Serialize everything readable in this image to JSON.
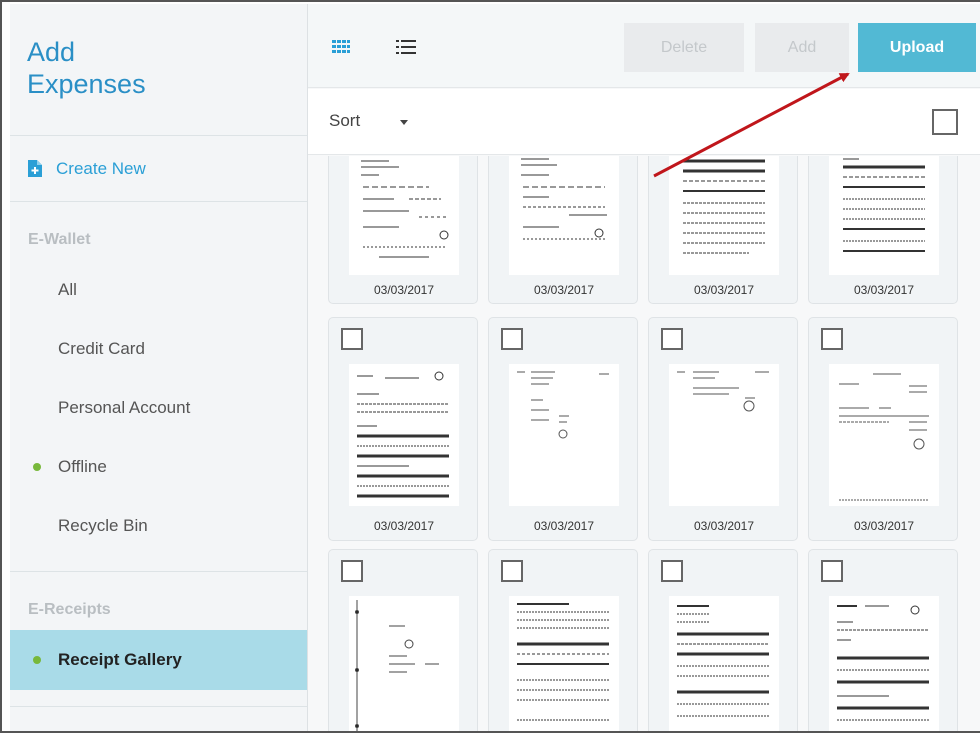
{
  "sidebar": {
    "title_line1": "Add",
    "title_line2": "Expenses",
    "create_new": "Create New",
    "ewallet_heading": "E-Wallet",
    "ewallet_items": [
      {
        "label": "All",
        "dot": false
      },
      {
        "label": "Credit Card",
        "dot": false
      },
      {
        "label": "Personal Account",
        "dot": false
      },
      {
        "label": "Offline",
        "dot": true
      },
      {
        "label": "Recycle Bin",
        "dot": false
      }
    ],
    "ereceipts_heading": "E-Receipts",
    "receipt_gallery": "Receipt Gallery"
  },
  "toolbar": {
    "delete_label": "Delete",
    "add_label": "Add",
    "upload_label": "Upload"
  },
  "sort": {
    "label": "Sort"
  },
  "gallery": {
    "row1_dates": [
      "03/03/2017",
      "03/03/2017",
      "03/03/2017",
      "03/03/2017"
    ],
    "row2_dates": [
      "03/03/2017",
      "03/03/2017",
      "03/03/2017",
      "03/03/2017"
    ]
  },
  "colors": {
    "accent": "#2a8fc6",
    "upload": "#52b9d4",
    "active_item": "#a9dbe8",
    "status_dot": "#78b83b",
    "annotation_arrow": "#c0161b"
  }
}
